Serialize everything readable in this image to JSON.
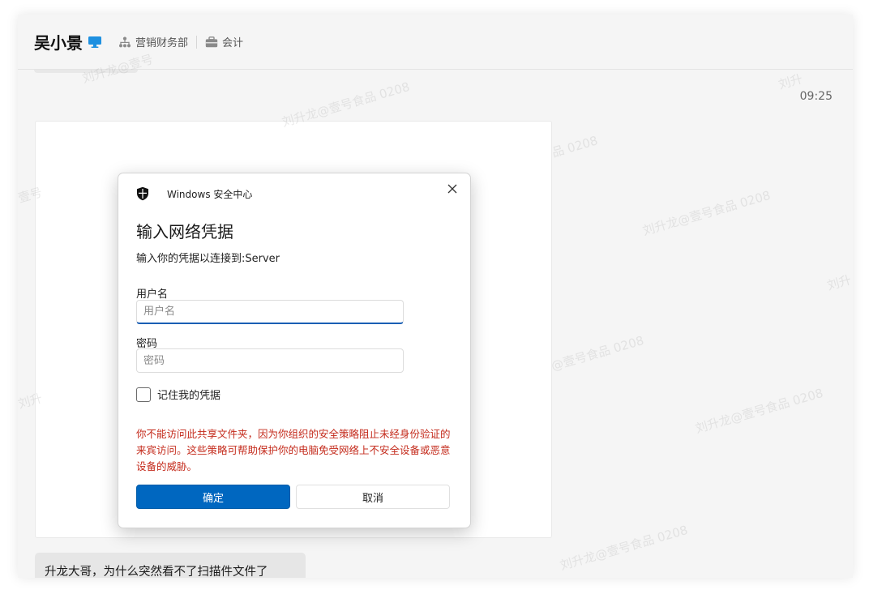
{
  "header": {
    "contact_name": "吴小景",
    "department": "营销财务部",
    "role": "会计"
  },
  "chat": {
    "timestamp": "09:25",
    "message_text": "升龙大哥，为什么突然看不了扫描件文件了"
  },
  "dialog": {
    "app_title": "Windows 安全中心",
    "title": "输入网络凭据",
    "subtitle": "输入你的凭据以连接到:Server",
    "username_label": "用户名",
    "username_placeholder": "用户名",
    "password_label": "密码",
    "password_placeholder": "密码",
    "remember_label": "记住我的凭据",
    "error_message": "你不能访问此共享文件夹，因为你组织的安全策略阻止未经身份验证的来宾访问。这些策略可帮助保护你的电脑免受网络上不安全设备或恶意设备的威胁。",
    "ok_label": "确定",
    "cancel_label": "取消"
  },
  "watermark": {
    "full": "刘升龙@壹号食品 0208",
    "w1": "刘升龙@壹号",
    "w2": "刘升龙@壹号食品 0208",
    "w3": "品 0208",
    "w4": "刘升龙@壹号食品 0208",
    "w5": "刘升",
    "w6": "@壹号食品 0208",
    "w7": "刘升龙@壹号食品 0208",
    "w8": "刘升龙@壹号食品 0208",
    "w9": "刘升",
    "w10": "壹号",
    "w11": "刘升"
  },
  "colors": {
    "accent": "#0067c0",
    "error": "#c42b1c",
    "device_icon": "#1e90e0"
  }
}
